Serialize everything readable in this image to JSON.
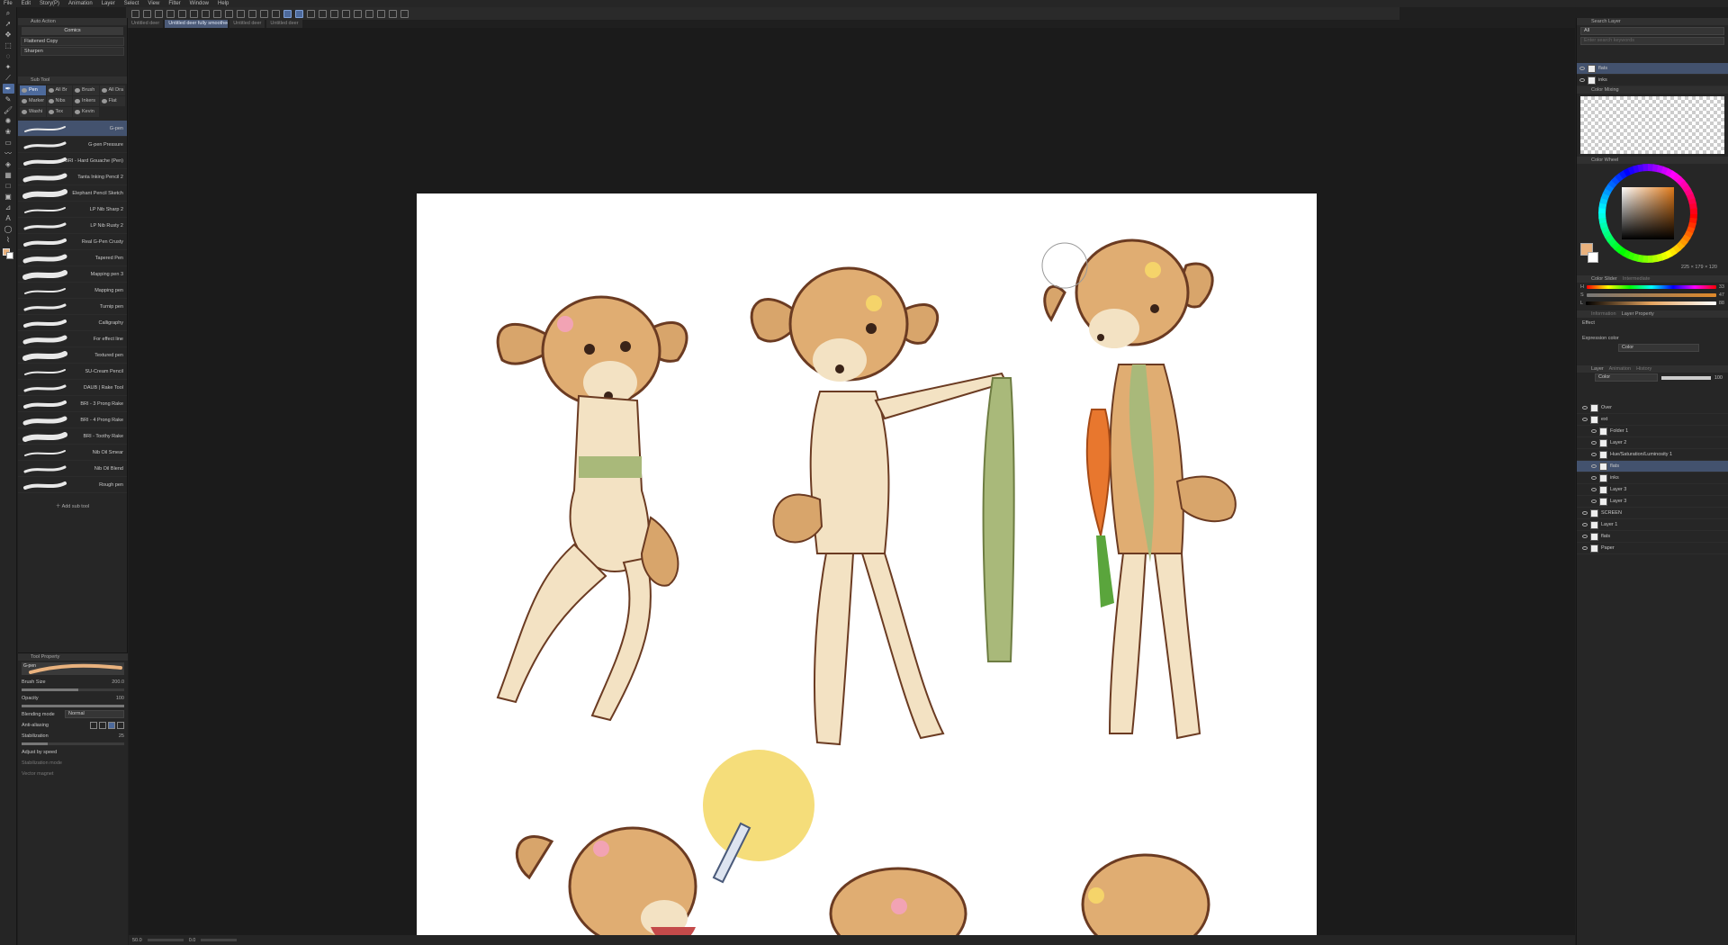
{
  "menu": [
    "File",
    "Edit",
    "Story(P)",
    "Animation",
    "Layer",
    "Select",
    "View",
    "Filter",
    "Window",
    "Help"
  ],
  "doc_tabs": [
    {
      "label": "Untitled deer",
      "active": false
    },
    {
      "label": "Untitled deer fully smoothed",
      "active": true
    },
    {
      "label": "Untitled deer",
      "active": false
    },
    {
      "label": "Untitled deer",
      "active": false
    }
  ],
  "auto_action": {
    "header": "Auto Action",
    "set": "Comics",
    "items": [
      "Flattened Copy",
      "Sharpen"
    ]
  },
  "subtool": {
    "header": "Sub Tool",
    "tabs": [
      {
        "label": "Pen",
        "active": true
      },
      {
        "label": "All Br",
        "active": false
      },
      {
        "label": "Brush",
        "active": false
      },
      {
        "label": "All Dra",
        "active": false
      },
      {
        "label": "Marker",
        "active": false
      },
      {
        "label": "Nibs",
        "active": false
      },
      {
        "label": "Inkers",
        "active": false
      },
      {
        "label": "Flat",
        "active": false
      },
      {
        "label": "Washi",
        "active": false
      },
      {
        "label": "Tex",
        "active": false
      },
      {
        "label": "Kevin",
        "active": false
      }
    ],
    "brushes": [
      "G-pen",
      "G-pen Pressure",
      "BRI - Hard Gouache (Pen)",
      "Tanta Inking Pencil 2",
      "Elephant Pencil Sketch",
      "LP Nib Sharp 2",
      "LP Nib Rusty 2",
      "Real G-Pen Crusty",
      "Tapered Pen",
      "Mapping pen 3",
      "Mapping pen",
      "Turnip pen",
      "Calligraphy",
      "For effect line",
      "Textured pen",
      "SU-Cream Pencil",
      "DAUB | Rake Tool",
      "BRI - 3 Prong Rake",
      "BRI - 4 Prong Rake",
      "BRI - Toothy Rake",
      "Nib Oil Smear",
      "Nib Oil Blend",
      "Rough pen"
    ],
    "add_label": "Add sub tool"
  },
  "tool_property": {
    "header": "Tool Property",
    "preview_label": "G-pen",
    "brush_size_label": "Brush Size",
    "brush_size": "200.0",
    "opacity_label": "Opacity",
    "opacity": "100",
    "blending_label": "Blending mode",
    "blending": "Normal",
    "antialias_label": "Anti-aliasing",
    "stabilization_label": "Stabilization",
    "stabilization": "25",
    "adjust_speed_label": "Adjust by speed",
    "stab_mode_label": "Stabilization mode",
    "vector_magnet_label": "Vector magnet"
  },
  "search_layer": {
    "header": "Search Layer",
    "filter": "All",
    "placeholder": "Enter search keywords",
    "layers": [
      "flats",
      "inks"
    ]
  },
  "color_mixing_header": "Color Mixing",
  "color_wheel": {
    "header": "Color Wheel",
    "readout": "225 × 179 × 120",
    "main_color": "#e9b27e",
    "sub_color": "#ffffff"
  },
  "color_slider": {
    "tabs": [
      "Color Slider",
      "Intermediate"
    ],
    "rows": [
      {
        "label": "H",
        "value": "33"
      },
      {
        "label": "S",
        "value": "47"
      },
      {
        "label": "L",
        "value": "88"
      }
    ]
  },
  "layer_property": {
    "tabs": [
      "Information",
      "Layer Property"
    ],
    "effect_label": "Effect",
    "expression_label": "Expression color",
    "expression": "Color"
  },
  "layer_panel": {
    "tabs": [
      "Layer",
      "Animation",
      "History"
    ],
    "blend": "Color",
    "opacity": "100",
    "layers": [
      {
        "name": "Over",
        "indent": 0,
        "selected": false
      },
      {
        "name": "ext",
        "indent": 0,
        "selected": false
      },
      {
        "name": "Folder 1",
        "indent": 1,
        "selected": false
      },
      {
        "name": "Layer 2",
        "indent": 1,
        "selected": false
      },
      {
        "name": "Hue/Saturation/Luminosity 1",
        "indent": 1,
        "selected": false
      },
      {
        "name": "flats",
        "indent": 1,
        "selected": true
      },
      {
        "name": "inks",
        "indent": 1,
        "selected": false
      },
      {
        "name": "Layer 3",
        "indent": 1,
        "selected": false
      },
      {
        "name": "Layer 3",
        "indent": 1,
        "selected": false
      },
      {
        "name": "SCREEN",
        "indent": 0,
        "selected": false
      },
      {
        "name": "Layer 1",
        "indent": 0,
        "selected": false
      },
      {
        "name": "flats",
        "indent": 0,
        "selected": false
      },
      {
        "name": "Paper",
        "indent": 0,
        "selected": false
      }
    ]
  },
  "status": {
    "zoom": "50.0",
    "rotation": "0.0"
  }
}
